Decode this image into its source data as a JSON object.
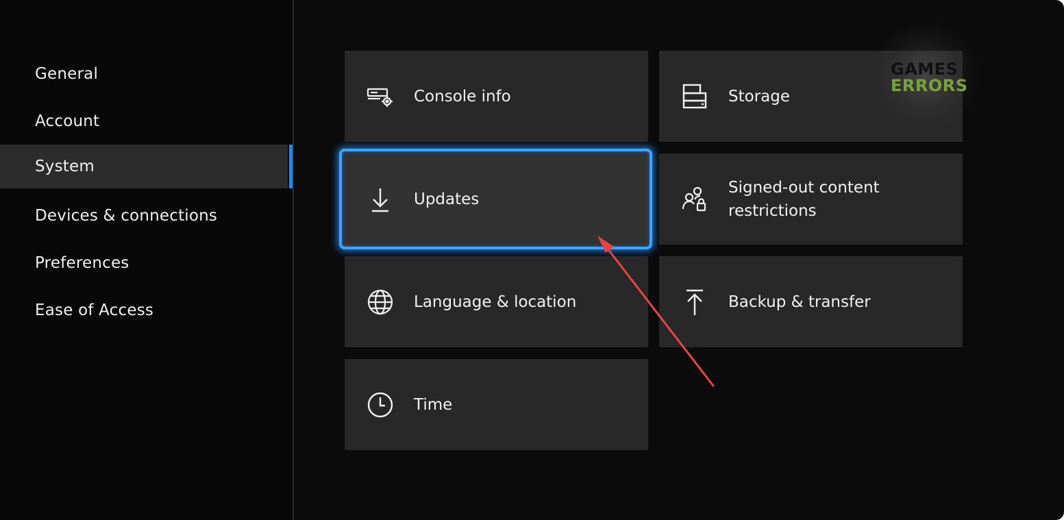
{
  "sidebar": {
    "items": [
      {
        "label": "General"
      },
      {
        "label": "Account"
      },
      {
        "label": "System"
      },
      {
        "label": "Devices & connections"
      },
      {
        "label": "Preferences"
      },
      {
        "label": "Ease of Access"
      }
    ],
    "selected": "System"
  },
  "tiles": {
    "console_info": {
      "label": "Console info",
      "icon": "console-info-icon"
    },
    "storage": {
      "label": "Storage",
      "icon": "storage-icon"
    },
    "updates": {
      "label": "Updates",
      "icon": "download-icon"
    },
    "signed_out": {
      "label_line1": "Signed-out content",
      "label_line2": "restrictions",
      "icon": "family-lock-icon"
    },
    "language": {
      "label": "Language & location",
      "icon": "globe-icon"
    },
    "backup": {
      "label": "Backup & transfer",
      "icon": "upload-icon"
    },
    "time": {
      "label": "Time",
      "icon": "clock-icon"
    }
  },
  "watermark": {
    "line1": "GAMES",
    "line2": "ERRORS"
  },
  "colors": {
    "accent": "#2f86d8",
    "focus": "#3aa6ff",
    "annotation_arrow": "#e84545",
    "watermark_green": "#7aa23a"
  }
}
